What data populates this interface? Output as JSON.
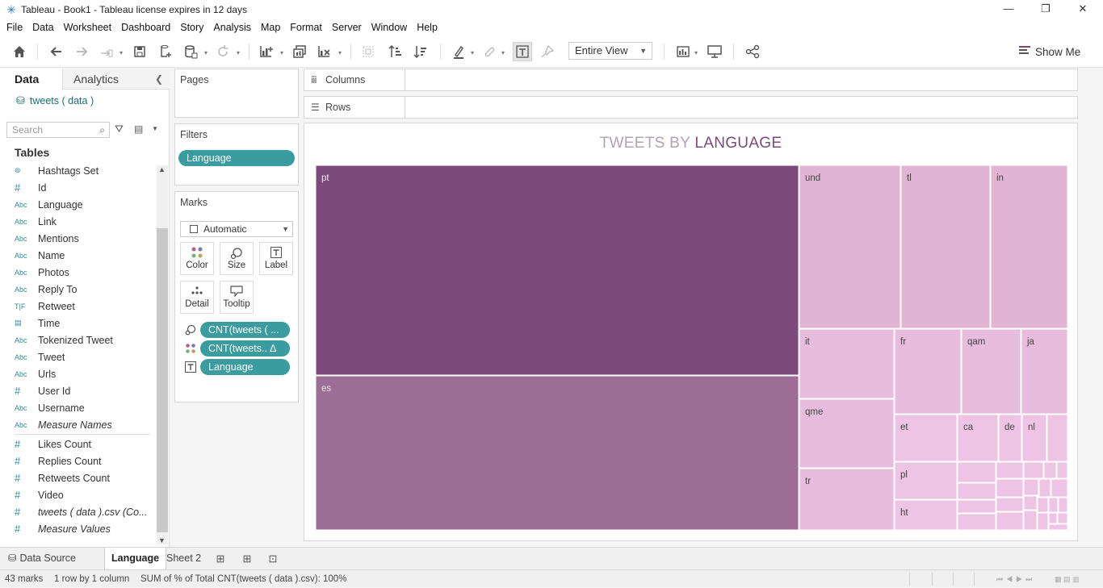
{
  "window": {
    "title": "Tableau - Book1 - Tableau license expires in 12 days",
    "minimize": "—",
    "maximize": "❐",
    "close": "✕"
  },
  "menu": [
    "File",
    "Data",
    "Worksheet",
    "Dashboard",
    "Story",
    "Analysis",
    "Map",
    "Format",
    "Server",
    "Window",
    "Help"
  ],
  "toolbar": {
    "fit_value": "Entire View",
    "show_me_label": "Show Me"
  },
  "data_pane": {
    "tabs": {
      "data": "Data",
      "analytics": "Analytics"
    },
    "datasource": "tweets ( data )",
    "search_placeholder": "Search",
    "tables_heading": "Tables",
    "dimensions": [
      {
        "type": "set",
        "type_label": "⊚",
        "name": "Hashtags Set"
      },
      {
        "type": "number",
        "type_label": "#",
        "name": "Id"
      },
      {
        "type": "string",
        "type_label": "Abc",
        "name": "Language"
      },
      {
        "type": "string",
        "type_label": "Abc",
        "name": "Link"
      },
      {
        "type": "string",
        "type_label": "Abc",
        "name": "Mentions"
      },
      {
        "type": "string",
        "type_label": "Abc",
        "name": "Name"
      },
      {
        "type": "string",
        "type_label": "Abc",
        "name": "Photos"
      },
      {
        "type": "string",
        "type_label": "Abc",
        "name": "Reply To"
      },
      {
        "type": "boolean",
        "type_label": "T|F",
        "name": "Retweet"
      },
      {
        "type": "date",
        "type_label": "▤",
        "name": "Time"
      },
      {
        "type": "string",
        "type_label": "Abc",
        "name": "Tokenized Tweet"
      },
      {
        "type": "string",
        "type_label": "Abc",
        "name": "Tweet"
      },
      {
        "type": "string",
        "type_label": "Abc",
        "name": "Urls"
      },
      {
        "type": "number",
        "type_label": "#",
        "name": "User Id"
      },
      {
        "type": "string",
        "type_label": "Abc",
        "name": "Username"
      },
      {
        "type": "string",
        "type_label": "Abc",
        "name": "Measure Names",
        "italic": true
      }
    ],
    "measures": [
      {
        "type": "number",
        "type_label": "#",
        "name": "Likes Count"
      },
      {
        "type": "number",
        "type_label": "#",
        "name": "Replies Count"
      },
      {
        "type": "number",
        "type_label": "#",
        "name": "Retweets Count"
      },
      {
        "type": "number",
        "type_label": "#",
        "name": "Video"
      },
      {
        "type": "number",
        "type_label": "#",
        "name": "tweets ( data ).csv (Co...",
        "italic": true
      },
      {
        "type": "number",
        "type_label": "#",
        "name": "Measure Values",
        "italic": true
      }
    ]
  },
  "pages": {
    "title": "Pages"
  },
  "filters": {
    "title": "Filters",
    "pills": [
      "Language"
    ]
  },
  "marks": {
    "title": "Marks",
    "type": "Automatic",
    "buttons": [
      "Color",
      "Size",
      "Label",
      "Detail",
      "Tooltip"
    ],
    "pills": [
      {
        "role": "size",
        "label": "CNT(tweets ( ..."
      },
      {
        "role": "color",
        "label": "CNT(tweets.. ∆"
      },
      {
        "role": "label",
        "label": "Language"
      }
    ]
  },
  "shelves": {
    "columns": "Columns",
    "rows": "Rows"
  },
  "view": {
    "title_prefix": "TWEETS BY ",
    "title_accent": "LANGUAGE"
  },
  "chart_data": {
    "type": "treemap",
    "title": "TWEETS BY LANGUAGE",
    "label_field": "Language",
    "size_measure": "CNT(tweets ( data ).csv)",
    "color_measure": "CNT(tweets ( data ).csv)",
    "labeled_rectangles": [
      "pt",
      "es",
      "und",
      "tl",
      "in",
      "it",
      "fr",
      "qam",
      "ja",
      "qme",
      "et",
      "ca",
      "de",
      "nl",
      "tr",
      "pl",
      "ht"
    ],
    "colors": {
      "pt": "#7b4a7b",
      "es": "#9c6e96",
      "high": "#e2b4d4",
      "mid": "#e8bcdc",
      "low": "#eec4e4"
    }
  },
  "sheet_tabs": {
    "data_source": "Data Source",
    "sheets": [
      "Language",
      "Sheet 2"
    ],
    "active": "Language"
  },
  "status": {
    "marks": "43 marks",
    "dims": "1 row by 1 column",
    "summary": "SUM of % of Total CNT(tweets ( data ).csv): 100%"
  }
}
